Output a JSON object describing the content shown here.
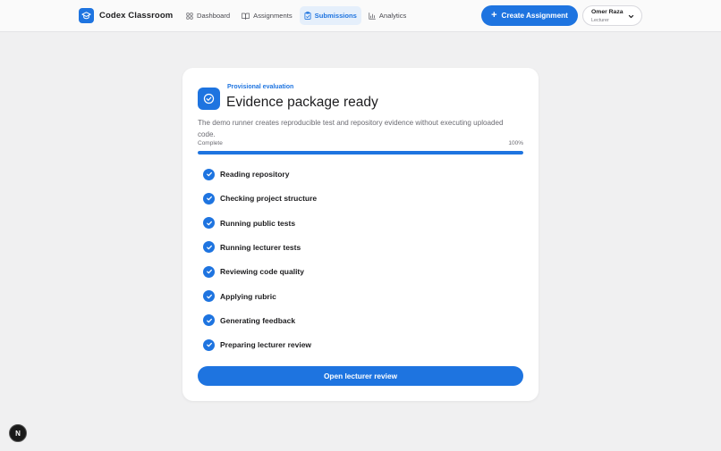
{
  "header": {
    "brand": "Codex Classroom",
    "nav": [
      {
        "label": "Dashboard",
        "icon": "grid-icon",
        "active": false
      },
      {
        "label": "Assignments",
        "icon": "book-icon",
        "active": false
      },
      {
        "label": "Submissions",
        "icon": "clipboard-icon",
        "active": true
      },
      {
        "label": "Analytics",
        "icon": "bar-chart-icon",
        "active": false
      }
    ],
    "create_button": "Create Assignment",
    "user": {
      "name": "Omer Raza",
      "role": "Lecturer"
    }
  },
  "card": {
    "eyebrow": "Provisional evaluation",
    "title": "Evidence package ready",
    "description": "The demo runner creates reproducible test and repository evidence without executing uploaded code.",
    "progress": {
      "label": "Complete",
      "percent_text": "100%",
      "value": 1.0
    },
    "steps": [
      "Reading repository",
      "Checking project structure",
      "Running public tests",
      "Running lecturer tests",
      "Reviewing code quality",
      "Applying rubric",
      "Generating feedback",
      "Preparing lecturer review"
    ],
    "open_button": "Open lecturer review"
  },
  "badge": {
    "letter": "N"
  },
  "colors": {
    "accent": "#1e74e0",
    "background": "#f0f0f1",
    "card": "#ffffff"
  }
}
